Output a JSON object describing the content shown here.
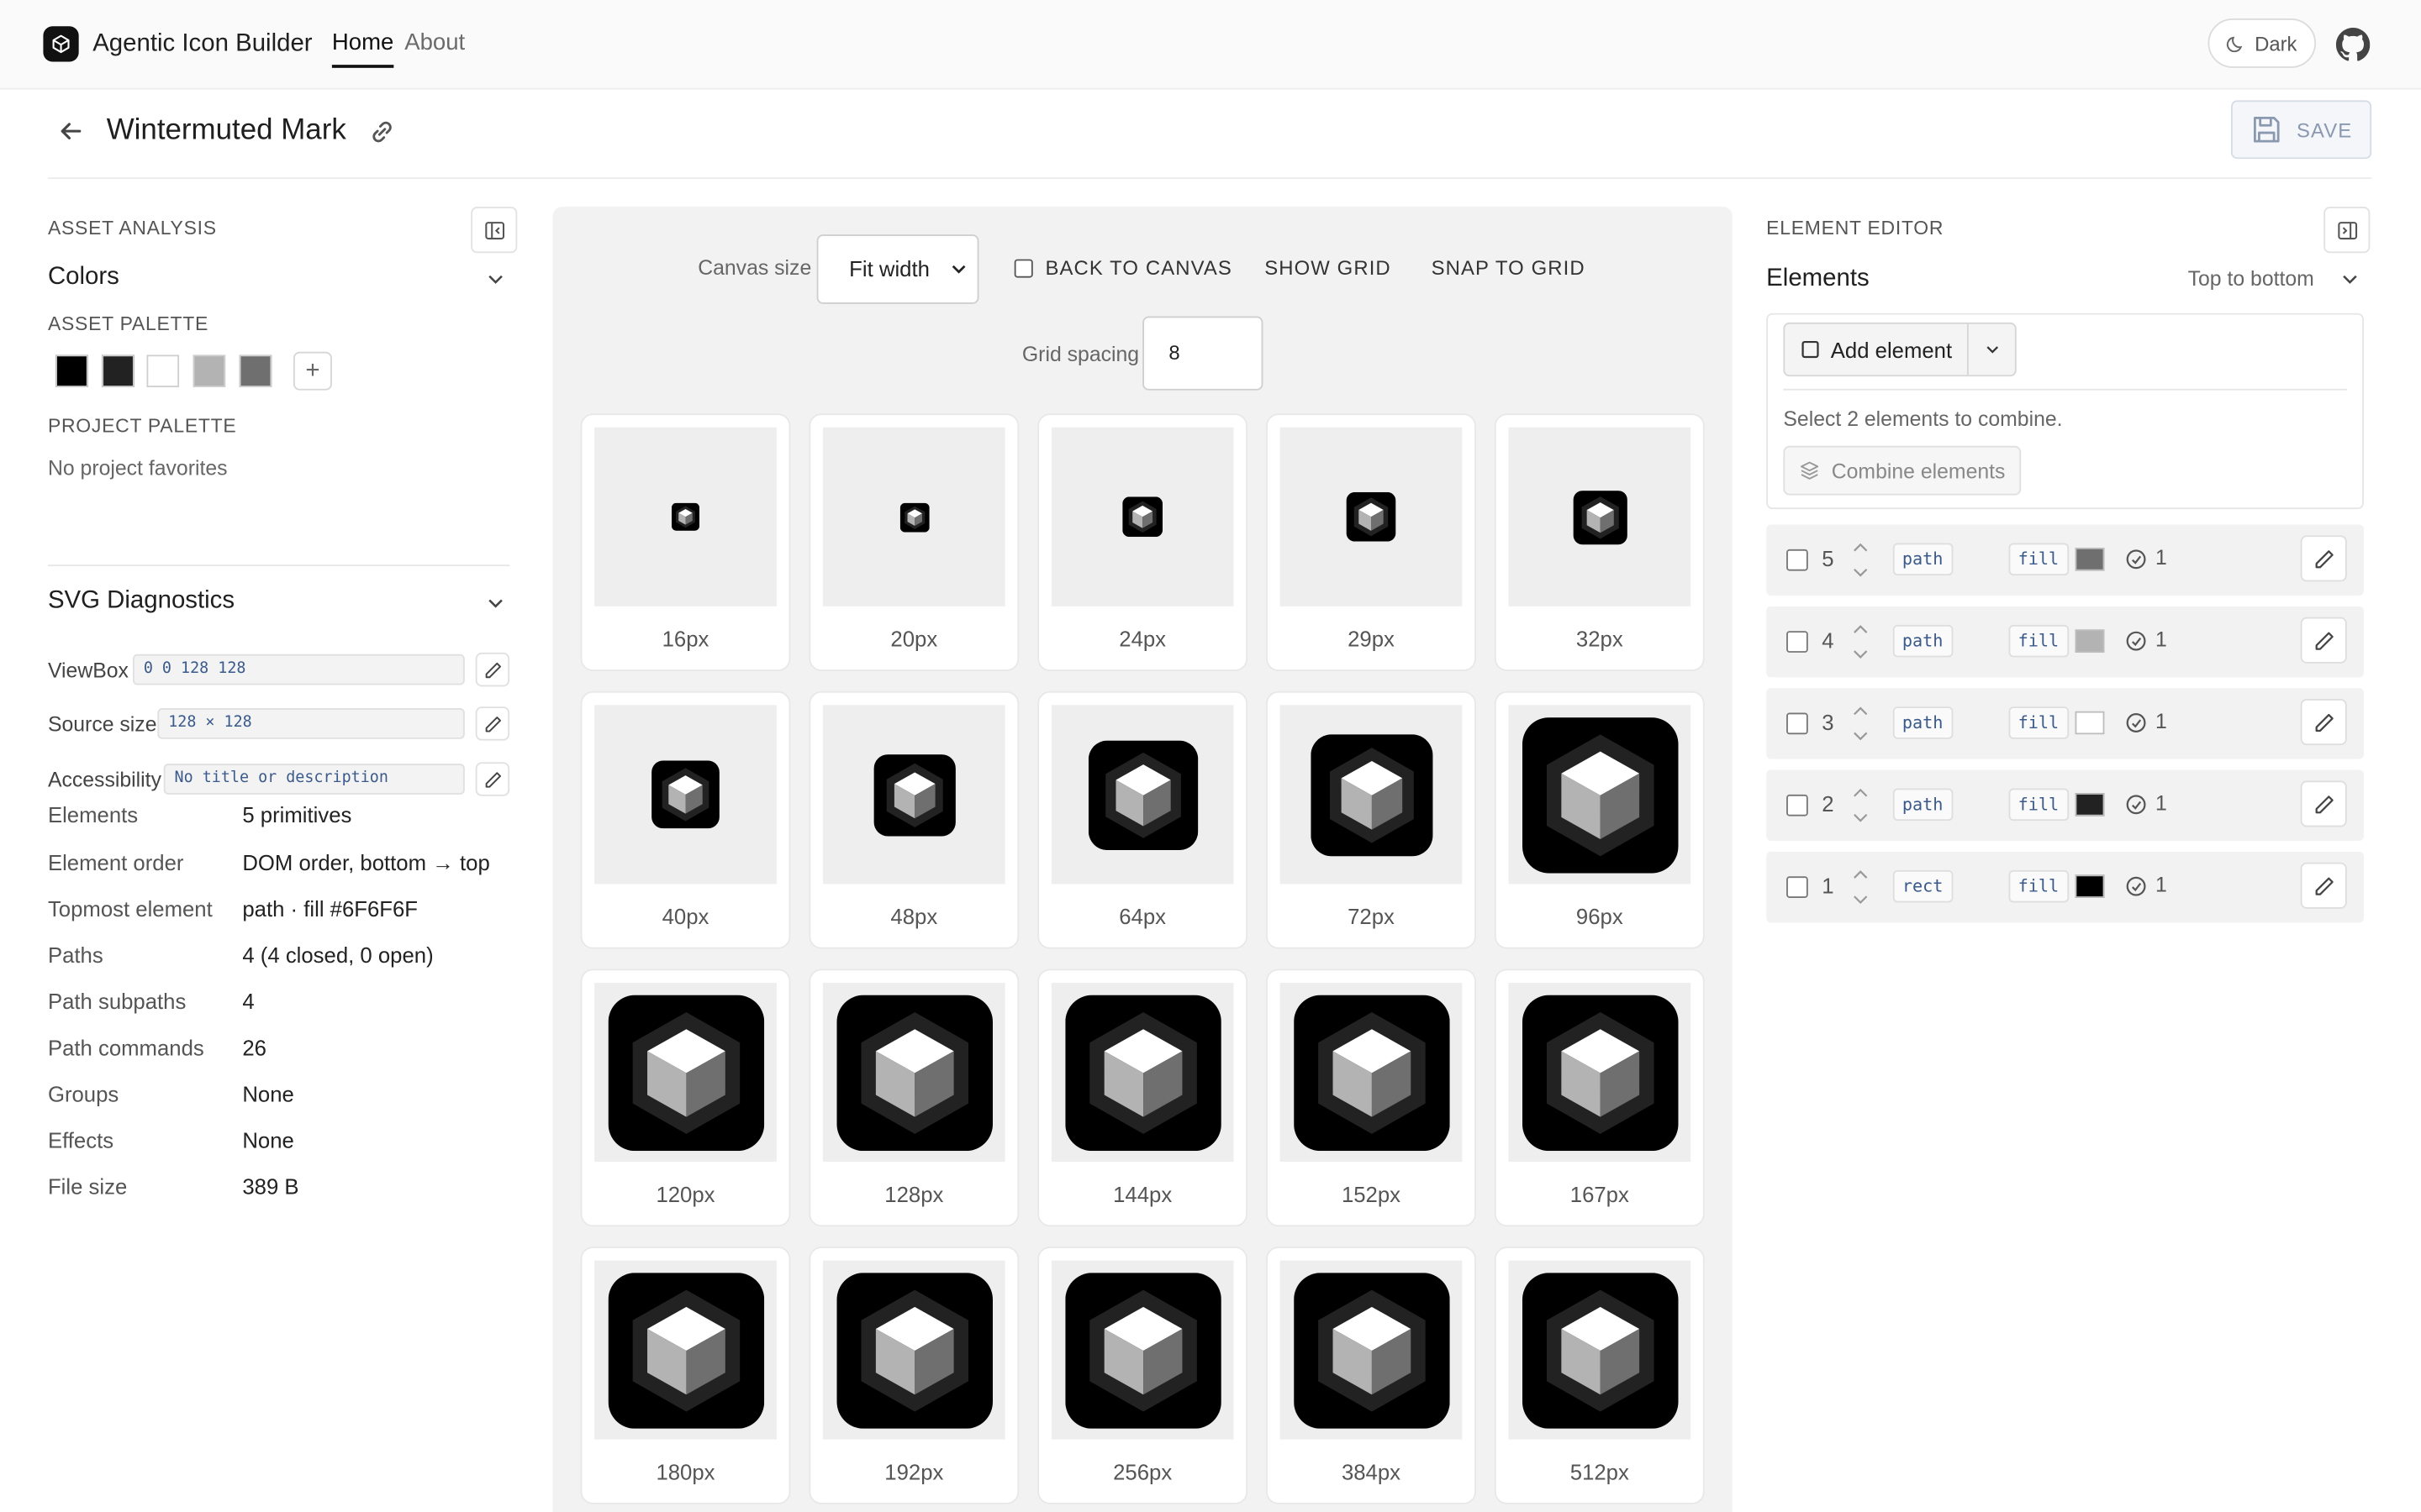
{
  "app": {
    "title": "Agentic Icon Builder",
    "nav": {
      "home": "Home",
      "about": "About"
    },
    "theme_button": "Dark"
  },
  "header": {
    "title": "Wintermuted Mark",
    "save_label": "SAVE"
  },
  "left_panel": {
    "section_label": "ASSET ANALYSIS",
    "colors": {
      "title": "Colors",
      "asset_palette_label": "ASSET PALETTE",
      "swatches": [
        "#000000",
        "#222222",
        "#FFFFFF",
        "#B3B3B3",
        "#6F6F6F"
      ],
      "add_label": "+",
      "project_palette_label": "PROJECT PALETTE",
      "project_empty": "No project favorites"
    },
    "diagnostics": {
      "title": "SVG Diagnostics",
      "viewbox_label": "ViewBox",
      "viewbox_value": "0 0 128 128",
      "source_size_label": "Source size",
      "source_size_value": "128 × 128",
      "accessibility_label": "Accessibility",
      "accessibility_value": "No title or description",
      "stats": [
        {
          "label": "Elements",
          "value": "5 primitives"
        },
        {
          "label": "Element order",
          "value": "DOM order, bottom → top"
        },
        {
          "label": "Topmost element",
          "value": "path · fill #6F6F6F"
        },
        {
          "label": "Paths",
          "value": "4 (4 closed, 0 open)"
        },
        {
          "label": "Path subpaths",
          "value": "4"
        },
        {
          "label": "Path commands",
          "value": "26"
        },
        {
          "label": "Groups",
          "value": "None"
        },
        {
          "label": "Effects",
          "value": "None"
        },
        {
          "label": "File size",
          "value": "389 B"
        }
      ]
    }
  },
  "canvas": {
    "canvas_size_label": "Canvas size",
    "canvas_size_value": "Fit width",
    "back_to_canvas": "BACK TO CANVAS",
    "show_grid": "SHOW GRID",
    "snap_to_grid": "SNAP TO GRID",
    "grid_spacing_label": "Grid spacing",
    "grid_spacing_value": "8",
    "sizes": [
      "16px",
      "20px",
      "24px",
      "29px",
      "32px",
      "40px",
      "48px",
      "64px",
      "72px",
      "96px",
      "120px",
      "128px",
      "144px",
      "152px",
      "167px",
      "180px",
      "192px",
      "256px",
      "384px",
      "512px"
    ]
  },
  "right_panel": {
    "section_label": "ELEMENT EDITOR",
    "title": "Elements",
    "sort_label": "Top to bottom",
    "add_element": "Add element",
    "combine_hint": "Select 2 elements to combine.",
    "combine_button": "Combine elements",
    "rows": [
      {
        "index": "5",
        "type": "path",
        "paint": "fill",
        "color": "#6F6F6F",
        "opacity": "1"
      },
      {
        "index": "4",
        "type": "path",
        "paint": "fill",
        "color": "#B3B3B3",
        "opacity": "1"
      },
      {
        "index": "3",
        "type": "path",
        "paint": "fill",
        "color": "#FFFFFF",
        "opacity": "1"
      },
      {
        "index": "2",
        "type": "path",
        "paint": "fill",
        "color": "#222222",
        "opacity": "1"
      },
      {
        "index": "1",
        "type": "rect",
        "paint": "fill",
        "color": "#000000",
        "opacity": "1"
      }
    ]
  }
}
